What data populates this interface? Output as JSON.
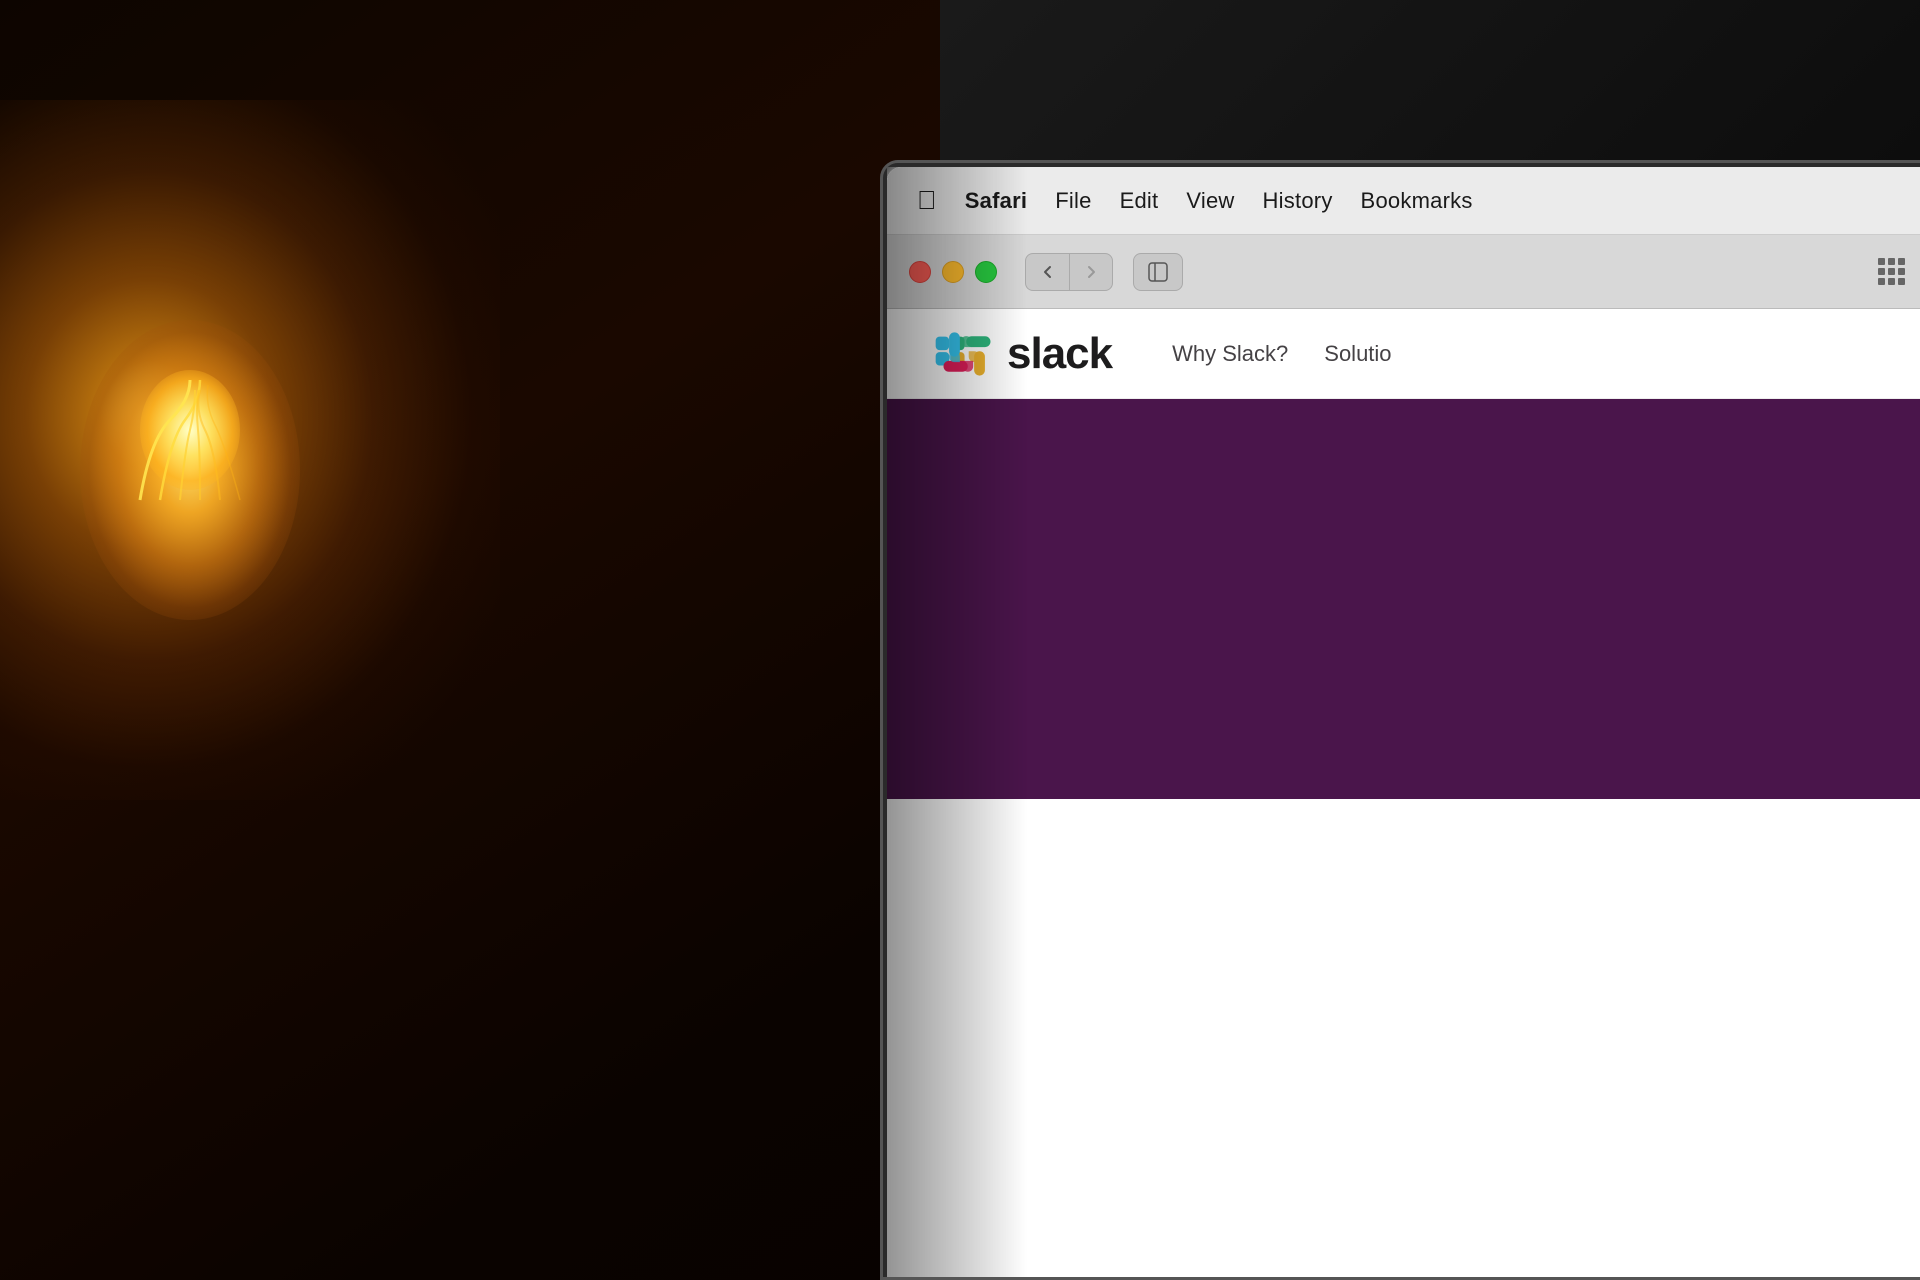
{
  "background": {
    "color": "#0a0500"
  },
  "menu_bar": {
    "items": [
      {
        "id": "apple",
        "label": ""
      },
      {
        "id": "safari",
        "label": "Safari"
      },
      {
        "id": "file",
        "label": "File"
      },
      {
        "id": "edit",
        "label": "Edit"
      },
      {
        "id": "view",
        "label": "View"
      },
      {
        "id": "history",
        "label": "History"
      },
      {
        "id": "bookmarks",
        "label": "Bookmarks"
      }
    ]
  },
  "browser": {
    "back_button": "‹",
    "forward_button": "›",
    "nav_back": "<",
    "nav_forward": ">"
  },
  "slack": {
    "wordmark": "slack",
    "nav_links": [
      "Why Slack?",
      "Solutio"
    ],
    "hero_color": "#4A154B"
  }
}
